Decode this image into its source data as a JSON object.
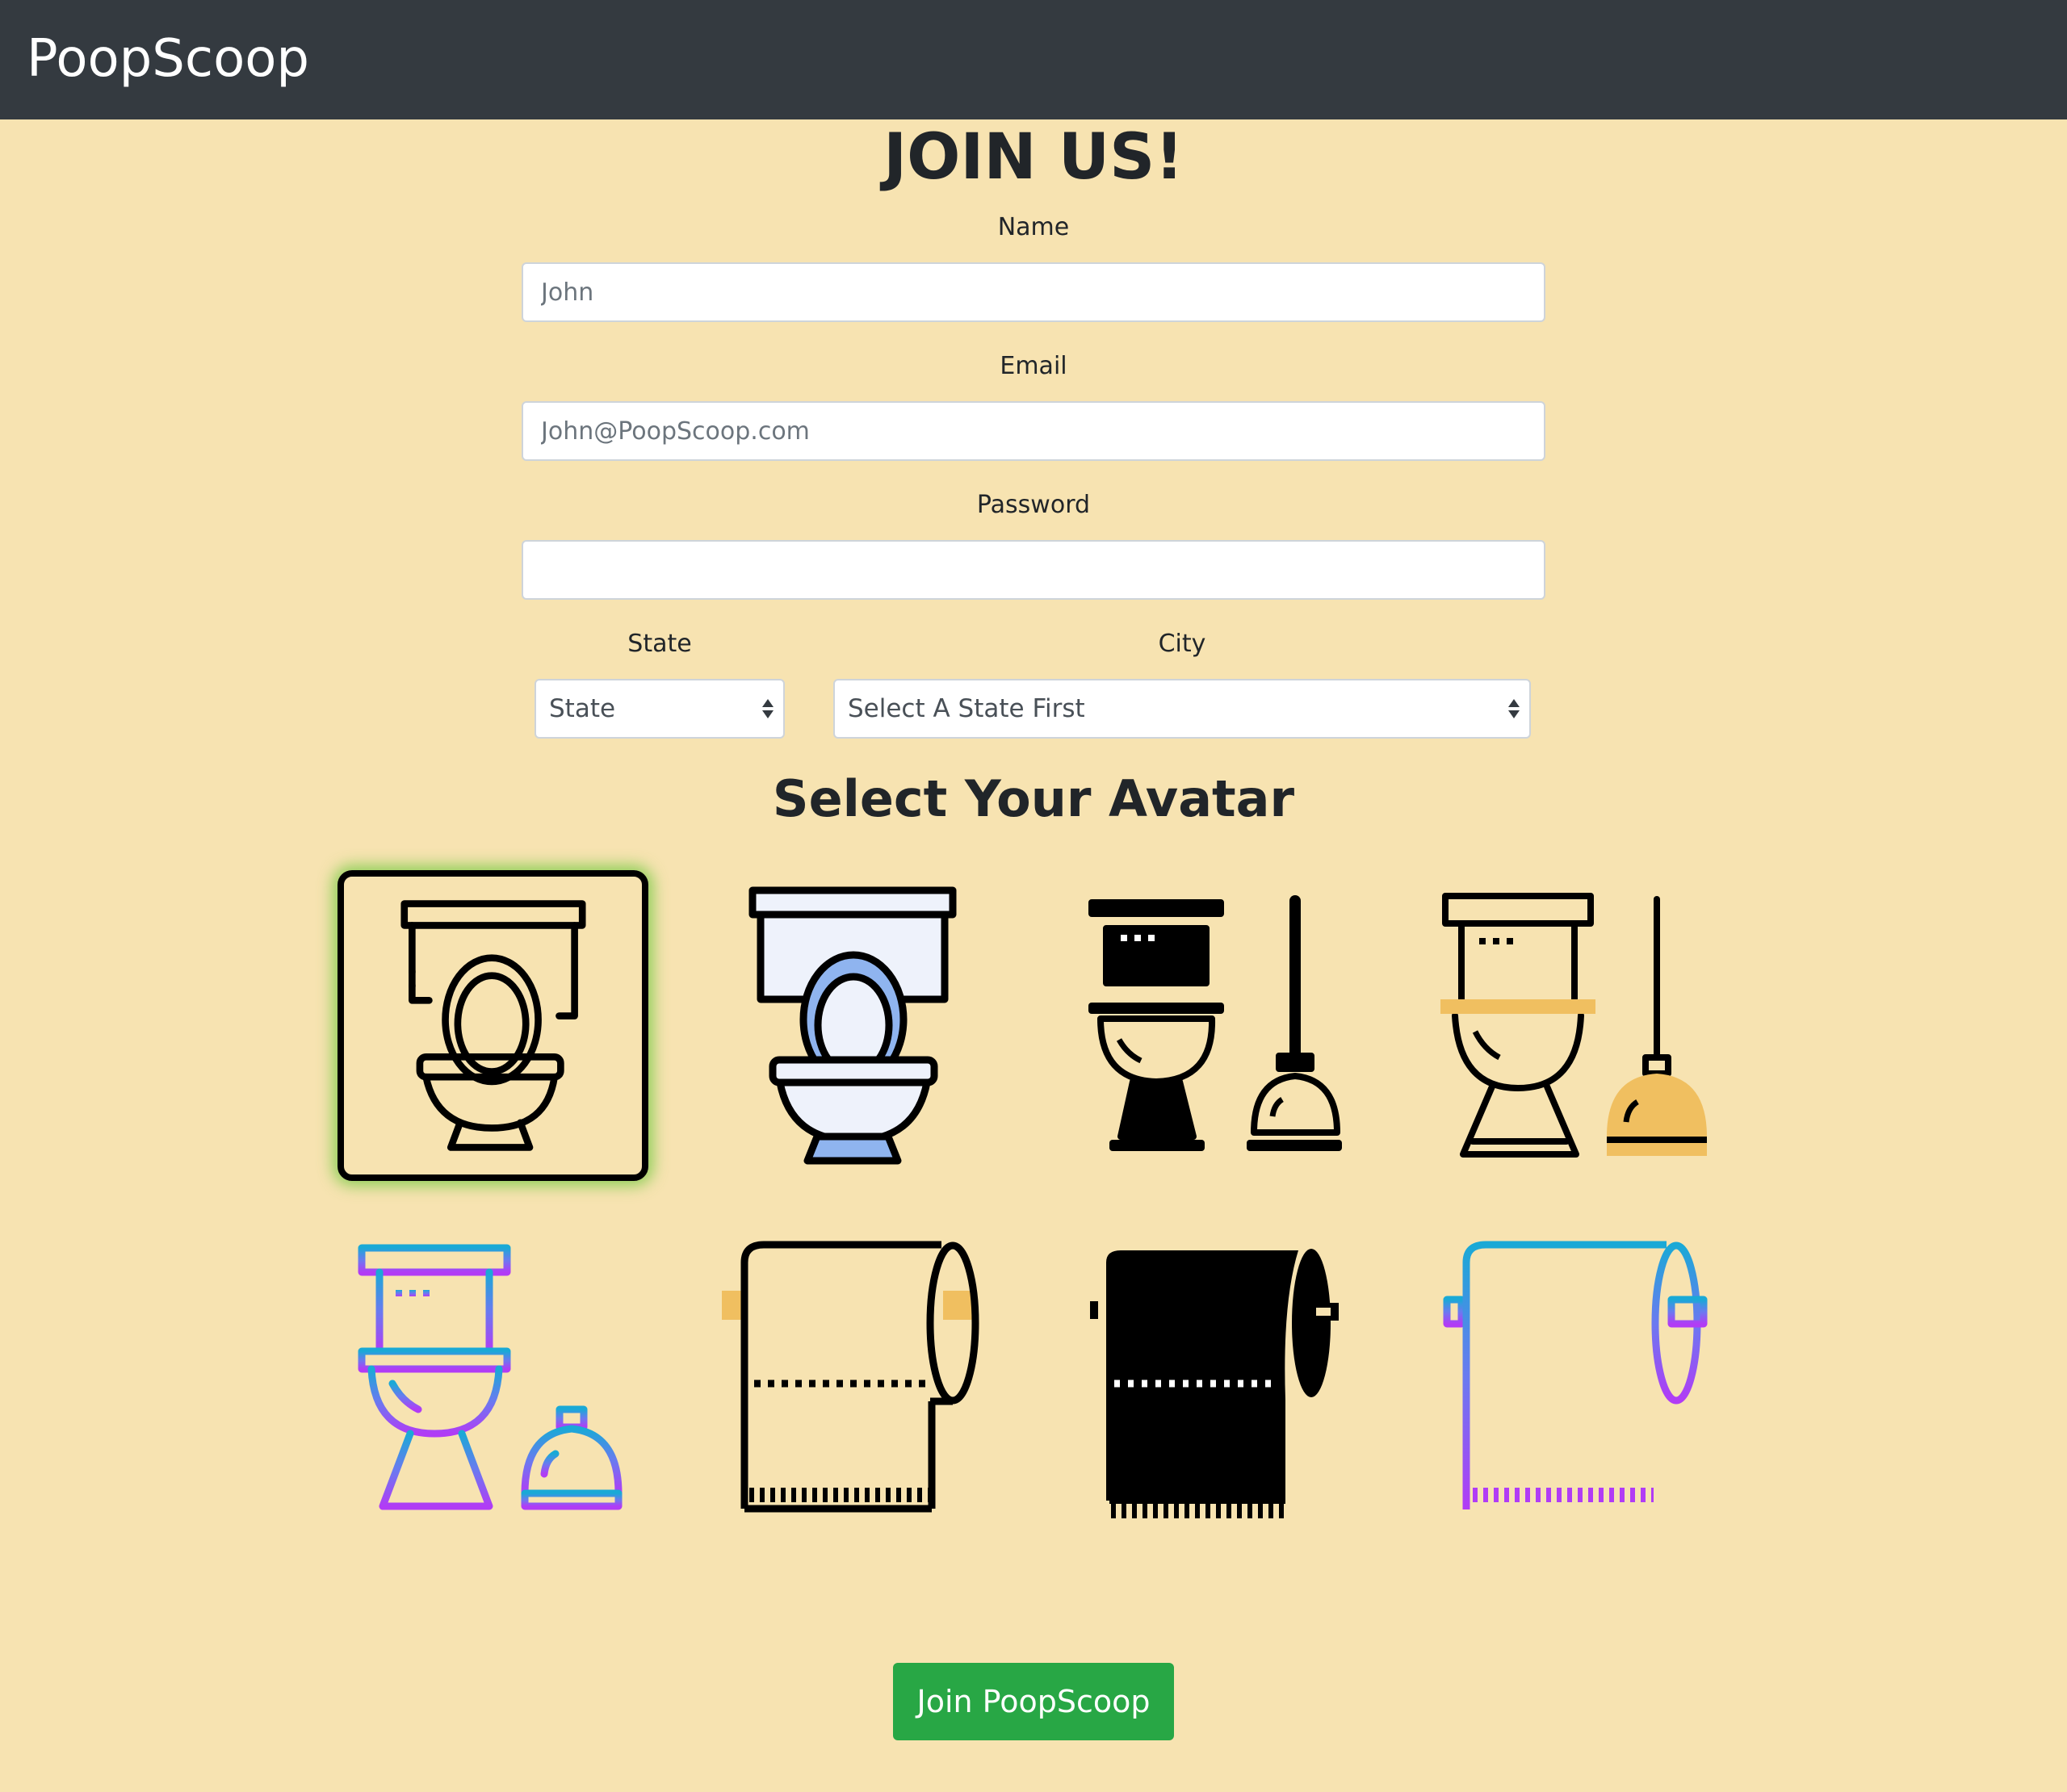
{
  "navbar": {
    "brand": "PoopScoop"
  },
  "form": {
    "title": "JOIN US!",
    "name_label": "Name",
    "name_placeholder": "John",
    "email_label": "Email",
    "email_placeholder": "John@PoopScoop.com",
    "password_label": "Password",
    "password_value": "",
    "state_label": "State",
    "state_value": "State",
    "city_label": "City",
    "city_value": "Select A State First"
  },
  "avatars": {
    "heading": "Select Your Avatar",
    "selected_index": 0,
    "items": [
      {
        "icon": "toilet-outline-icon"
      },
      {
        "icon": "toilet-color-icon"
      },
      {
        "icon": "toilet-plunger-solid-icon"
      },
      {
        "icon": "toilet-plunger-color-icon"
      },
      {
        "icon": "toilet-plunger-gradient-icon"
      },
      {
        "icon": "toilet-paper-color-icon"
      },
      {
        "icon": "toilet-paper-solid-icon"
      },
      {
        "icon": "toilet-paper-gradient-icon"
      }
    ]
  },
  "submit": {
    "label": "Join PoopScoop"
  },
  "colors": {
    "background": "#f7e3b1",
    "navbar": "#343a40",
    "button": "#28a745",
    "selected_glow": "#6ec83c",
    "accent_blue": "#8fb4ef",
    "accent_orange": "#f0bf60",
    "gradient_top": "#1aa9d6",
    "gradient_bottom": "#b13cf5"
  }
}
